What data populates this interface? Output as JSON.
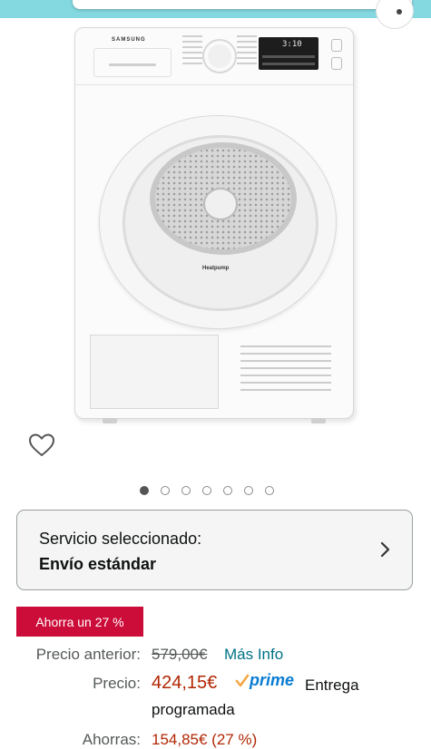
{
  "product_image": {
    "brand": "SAMSUNG",
    "display_digits": "3:10",
    "technology_logo": "Heatpump"
  },
  "icons": {
    "wishlist": "heart-outline-icon",
    "chevron": "chevron-right-icon",
    "prime_check": "prime-check-icon"
  },
  "carousel": {
    "total": 7,
    "active_index": 1
  },
  "service": {
    "title": "Servicio seleccionado:",
    "value": "Envío estándar"
  },
  "savings_badge": "Ahorra un 27 %",
  "pricing": {
    "previous_label": "Precio anterior:",
    "previous_value": "579,00€",
    "more_info": "Más Info",
    "price_label": "Precio:",
    "price_value": "424,15€",
    "prime": "prime",
    "delivery_line1": "Entrega",
    "delivery_line2": "programada",
    "savings_label": "Ahorras:",
    "savings_value": "154,85€ (27 %)"
  },
  "colors": {
    "header": "#84d8e0",
    "badge": "#cc0c39",
    "price": "#b12704",
    "link": "#007185",
    "prime": "#0a7dd1"
  }
}
